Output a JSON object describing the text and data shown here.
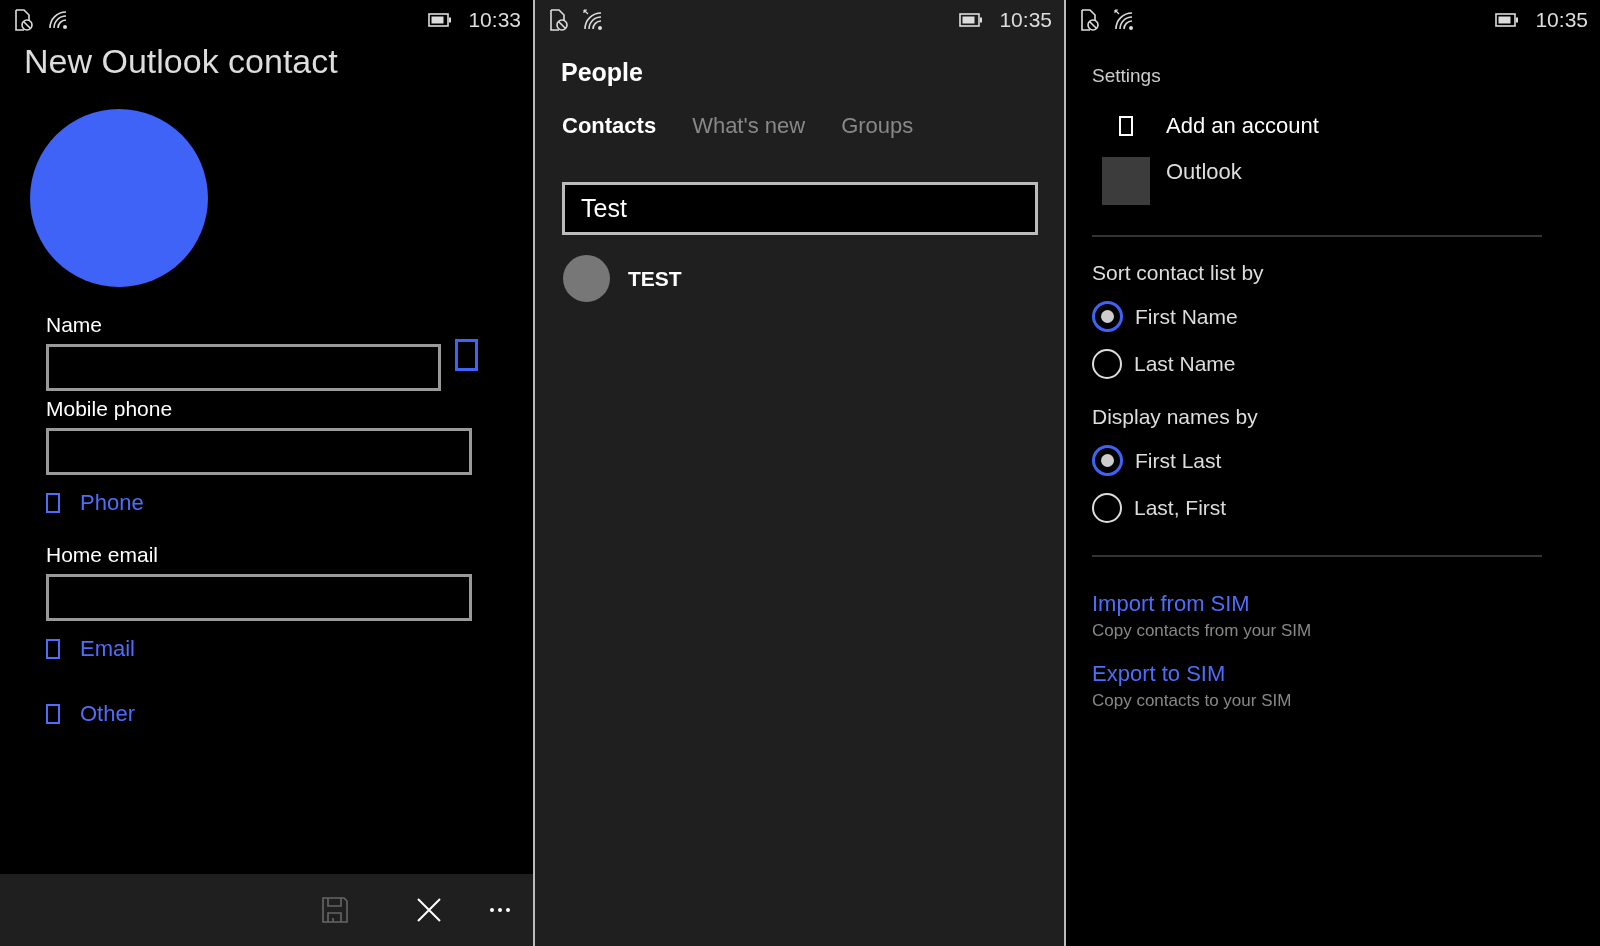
{
  "contact_form": {
    "status_bar": {
      "time": "10:33"
    },
    "title": "New Outlook contact",
    "items": [
      {
        "kind": "field-with-button",
        "label": "Name"
      },
      {
        "kind": "field",
        "label": "Mobile phone"
      },
      {
        "kind": "add",
        "label": "Phone"
      },
      {
        "kind": "field",
        "label": "Home email"
      },
      {
        "kind": "add",
        "label": "Email"
      },
      {
        "kind": "add",
        "label": "Other"
      }
    ],
    "app_bar": [
      {
        "kind": "save",
        "disabled": true
      },
      {
        "kind": "close",
        "disabled": false
      },
      {
        "kind": "more",
        "disabled": false
      }
    ]
  },
  "people": {
    "status_bar": {
      "time": "10:35"
    },
    "title": "People",
    "tabs": [
      {
        "label": "Contacts",
        "selected": true
      },
      {
        "label": "What's new",
        "selected": false
      },
      {
        "label": "Groups",
        "selected": false
      }
    ],
    "search": {
      "value": "Test"
    },
    "contacts": [
      {
        "name": "TEST"
      }
    ]
  },
  "settings": {
    "status_bar": {
      "time": "10:35"
    },
    "title": "Settings",
    "accounts": [
      {
        "kind": "add",
        "label": "Add an account"
      },
      {
        "kind": "account",
        "label": "Outlook"
      }
    ],
    "radio_groups": [
      {
        "title": "Sort contact list by",
        "options": [
          {
            "label": "First Name",
            "selected": true
          },
          {
            "label": "Last Name",
            "selected": false
          }
        ]
      },
      {
        "title": "Display names by",
        "options": [
          {
            "label": "First Last",
            "selected": true
          },
          {
            "label": "Last, First",
            "selected": false
          }
        ]
      }
    ],
    "links": [
      {
        "label": "Import from SIM",
        "description": "Copy contacts from your SIM"
      },
      {
        "label": "Export to SIM",
        "description": "Copy contacts to your SIM"
      }
    ]
  }
}
